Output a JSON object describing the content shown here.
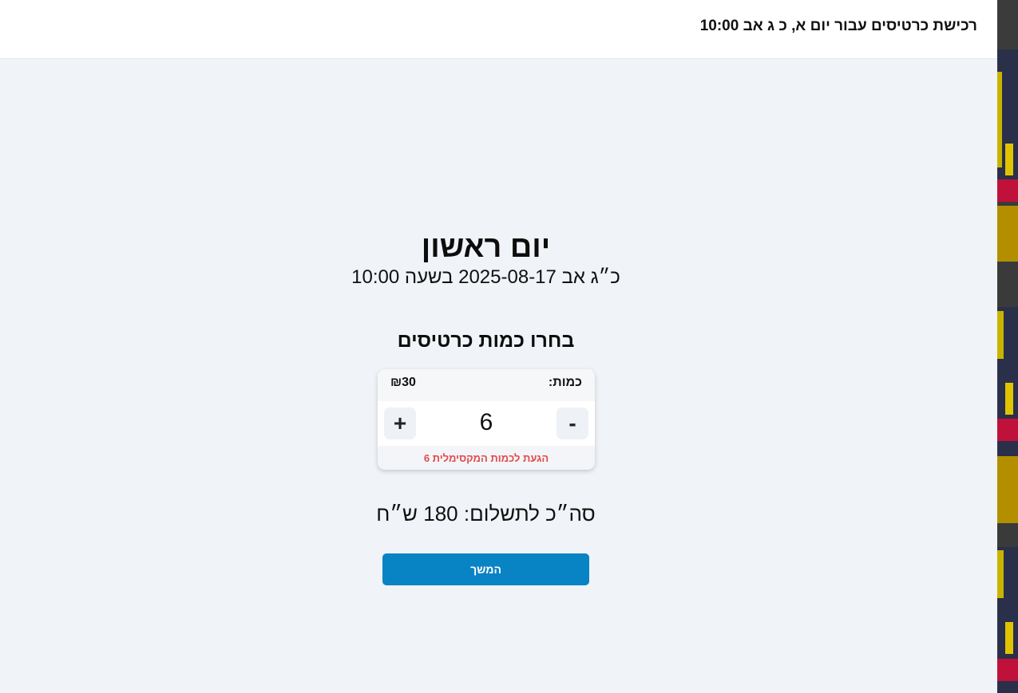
{
  "header": {
    "title": "רכישת כרטיסים עבור יום א, כ ג אב 10:00"
  },
  "event": {
    "day_name": "יום ראשון",
    "date_line": "כ״ג אב 2025-08-17 בשעה 10:00"
  },
  "tickets": {
    "section_title": "בחרו כמות כרטיסים",
    "quantity_label": "כמות:",
    "price": "₪30",
    "quantity_value": "6",
    "minus_label": "-",
    "plus_label": "+",
    "max_warning": "הגעת לכמות המקסימלית 6"
  },
  "summary": {
    "total": "סה״כ לתשלום: 180 ש״ח"
  },
  "actions": {
    "continue_label": "המשך"
  },
  "colors": {
    "background": "#f0f3f7",
    "accent": "#0883c4",
    "warning": "#e24a4a"
  }
}
